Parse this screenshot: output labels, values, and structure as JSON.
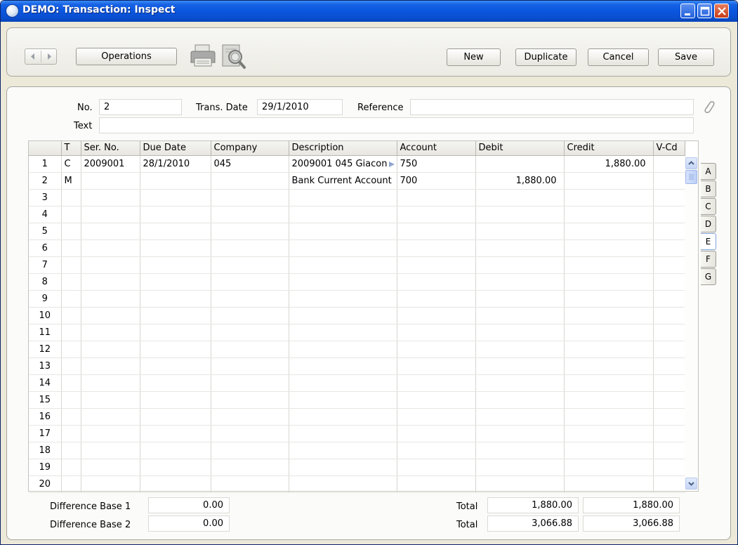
{
  "window": {
    "title": "DEMO: Transaction: Inspect"
  },
  "toolbar": {
    "operations": "Operations",
    "new": "New",
    "duplicate": "Duplicate",
    "cancel": "Cancel",
    "save": "Save"
  },
  "header": {
    "no_label": "No.",
    "no_value": "2",
    "trans_date_label": "Trans. Date",
    "trans_date_value": "29/1/2010",
    "reference_label": "Reference",
    "reference_value": "",
    "text_label": "Text",
    "text_value": ""
  },
  "grid": {
    "columns": [
      "T",
      "Ser. No.",
      "Due Date",
      "Company",
      "Description",
      "Account",
      "Debit",
      "Credit",
      "V-Cd"
    ],
    "rows": [
      {
        "n": "1",
        "t": "C",
        "serno": "2009001",
        "due": "28/1/2010",
        "company": "045",
        "desc": "2009001 045 Giacon",
        "account": "750",
        "debit": "",
        "credit": "1,880.00",
        "vcd": ""
      },
      {
        "n": "2",
        "t": "M",
        "serno": "",
        "due": "",
        "company": "",
        "desc": "Bank Current Account",
        "account": "700",
        "debit": "1,880.00",
        "credit": "",
        "vcd": ""
      },
      {
        "n": "3"
      },
      {
        "n": "4"
      },
      {
        "n": "5"
      },
      {
        "n": "6"
      },
      {
        "n": "7"
      },
      {
        "n": "8"
      },
      {
        "n": "9"
      },
      {
        "n": "10"
      },
      {
        "n": "11"
      },
      {
        "n": "12"
      },
      {
        "n": "13"
      },
      {
        "n": "14"
      },
      {
        "n": "15"
      },
      {
        "n": "16"
      },
      {
        "n": "17"
      },
      {
        "n": "18"
      },
      {
        "n": "19"
      },
      {
        "n": "20"
      }
    ]
  },
  "tabs": [
    "A",
    "B",
    "C",
    "D",
    "E",
    "F",
    "G"
  ],
  "active_tab": "E",
  "footer": {
    "diff1_label": "Difference Base 1",
    "diff1_value": "0.00",
    "diff2_label": "Difference Base 2",
    "diff2_value": "0.00",
    "total1_label": "Total",
    "total1_debit": "1,880.00",
    "total1_credit": "1,880.00",
    "total2_label": "Total",
    "total2_debit": "3,066.88",
    "total2_credit": "3,066.88"
  },
  "icons": {
    "print": "printer-icon",
    "preview": "print-preview-icon",
    "attach": "paperclip-icon"
  }
}
